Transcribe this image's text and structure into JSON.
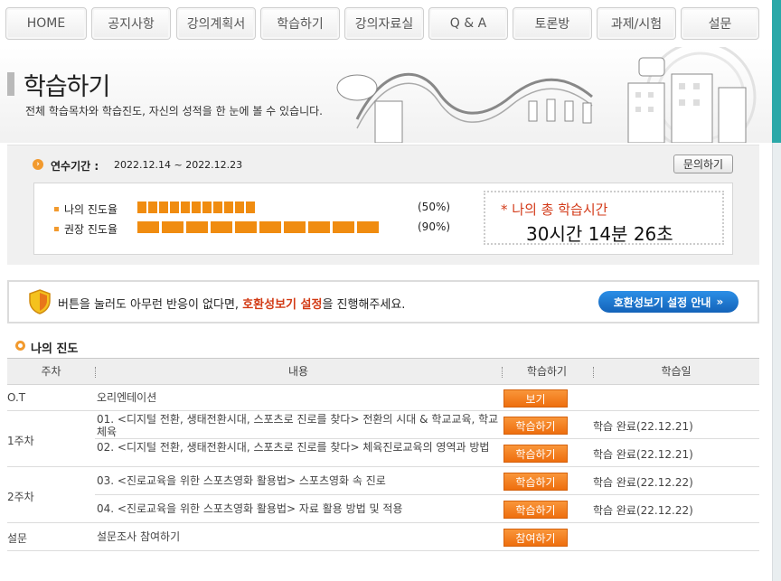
{
  "nav": {
    "items": [
      "HOME",
      "공지사항",
      "강의계획서",
      "학습하기",
      "강의자료실",
      "Q & A",
      "토론방",
      "과제/시험",
      "설문"
    ]
  },
  "header": {
    "title": "학습하기",
    "description": "전체 학습목차와 학습진도, 자신의 성적을 한 눈에 볼 수 있습니다."
  },
  "info": {
    "period_label": "연수기간 :",
    "period_value": "2022.12.14 ~ 2022.12.23",
    "inquiry_button": "문의하기",
    "my_progress_label": "나의 진도율",
    "my_progress_pct": "(50%)",
    "my_progress_value": 0.5,
    "recommended_label": "권장 진도율",
    "recommended_pct": "(90%)",
    "recommended_value": 0.9,
    "total_time_label": "나의 총 학습시간",
    "total_time_value": "30시간 14분 26초"
  },
  "notice": {
    "text_before": "버튼을 눌러도 아무런 반응이 없다면, ",
    "text_highlight": "호환성보기 설정",
    "text_after": "을 진행해주세요.",
    "button": "호환성보기 설정 안내"
  },
  "progress": {
    "section_title": "나의 진도",
    "headers": {
      "week": "주차",
      "content": "내용",
      "action": "학습하기",
      "date": "학습일"
    },
    "rows": [
      {
        "week": "O.T",
        "content": "오리엔테이션",
        "button": "보기",
        "date": ""
      },
      {
        "week": "1주차",
        "content": "01. <디지털 전환, 생태전환시대, 스포츠로 진로를 찾다> 전환의 시대 & 학교교육, 학교체육",
        "button": "학습하기",
        "date": "학습 완료(22.12.21)"
      },
      {
        "week": "",
        "content": "02. <디지털 전환, 생태전환시대, 스포츠로 진로를 찾다> 체육진로교육의 영역과 방법",
        "button": "학습하기",
        "date": "학습 완료(22.12.21)"
      },
      {
        "week": "2주차",
        "content": "03. <진로교육을 위한 스포츠영화 활용법> 스포츠영화 속 진로",
        "button": "학습하기",
        "date": "학습 완료(22.12.22)"
      },
      {
        "week": "",
        "content": "04. <진로교육을 위한 스포츠영화 활용법> 자료 활용 방법 및 적용",
        "button": "학습하기",
        "date": "학습 완료(22.12.22)"
      },
      {
        "week": "설문",
        "content": "설문조사 참여하기",
        "button": "참여하기",
        "date": ""
      }
    ]
  },
  "colors": {
    "accent_orange": "#f08c10",
    "highlight_red": "#d23a14",
    "button_blue": "#1463b9"
  }
}
